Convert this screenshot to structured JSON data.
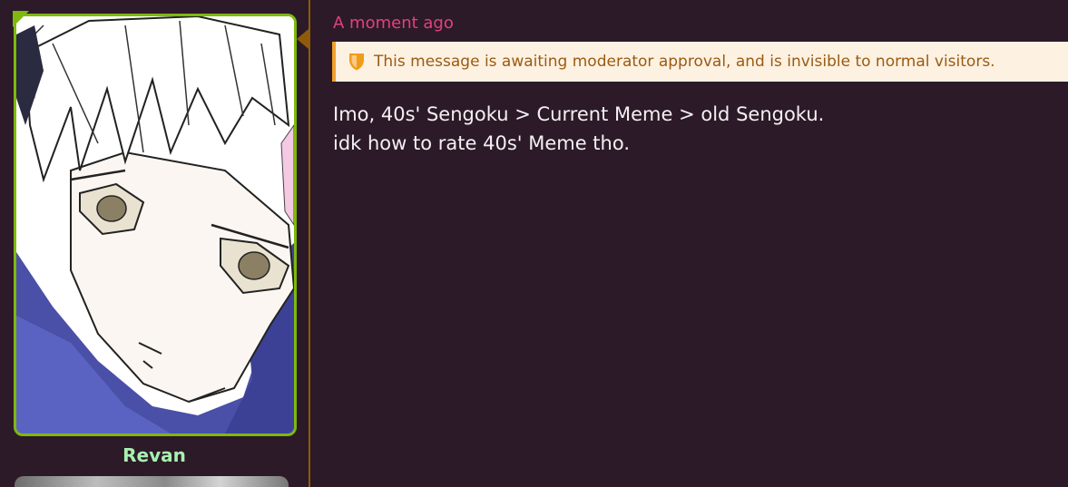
{
  "colors": {
    "background": "#2c1a28",
    "divider": "#8f5b0a",
    "avatar_border": "#7fb80e",
    "username": "#a8f0b0",
    "timestamp": "#e2417f",
    "notice_bg": "#fdf1e2",
    "notice_border": "#f0a02e",
    "notice_text": "#9a5b12",
    "notice_icon": "#f29b18",
    "body_text": "#f4f0f2"
  },
  "user": {
    "name": "Revan"
  },
  "message": {
    "timestamp": "A moment ago",
    "notice": {
      "icon": "shield-icon",
      "text": "This message is awaiting moderator approval, and is invisible to normal visitors."
    },
    "lines": [
      "Imo, 40s' Sengoku > Current Meme > old Sengoku.",
      "idk how to rate 40s' Meme tho."
    ]
  }
}
